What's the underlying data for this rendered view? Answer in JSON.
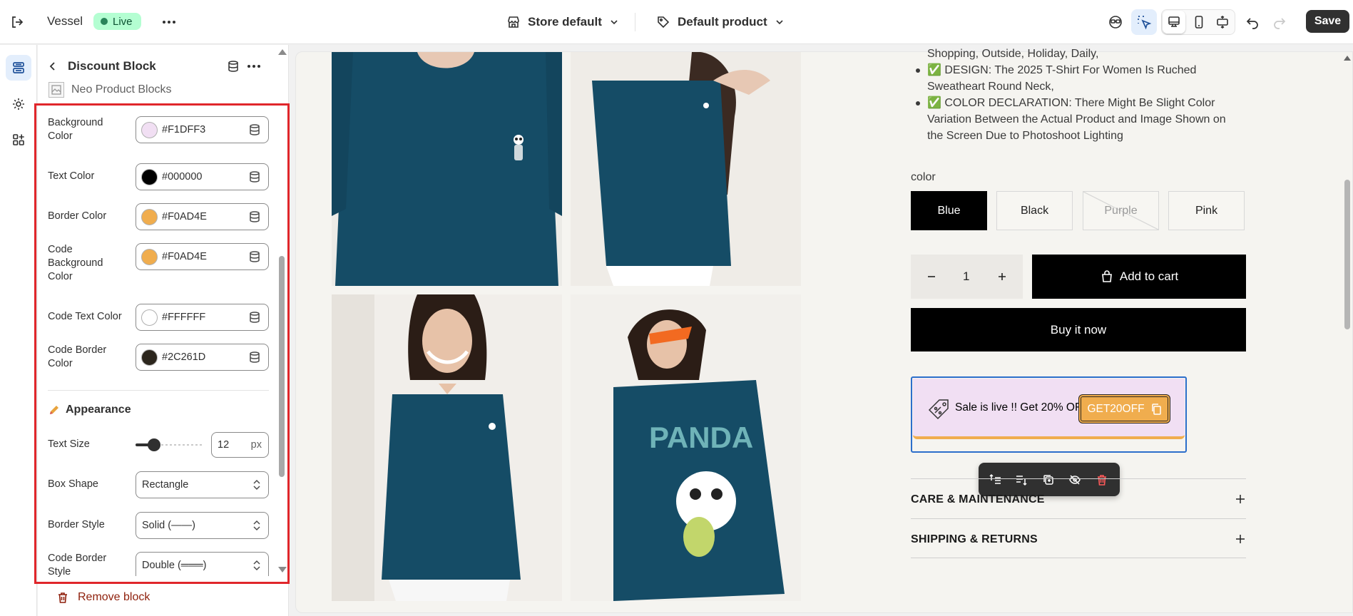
{
  "topbar": {
    "store_name": "Vessel",
    "status_badge": "Live",
    "theme_selector": "Store default",
    "template_selector": "Default product",
    "save_label": "Save"
  },
  "panel": {
    "title": "Discount Block",
    "app_name": "Neo Product Blocks",
    "fields": [
      {
        "label": "Background Color",
        "value": "#F1DFF3",
        "swatch": "#F1DFF3"
      },
      {
        "label": "Text Color",
        "value": "#000000",
        "swatch": "#000000"
      },
      {
        "label": "Border Color",
        "value": "#F0AD4E",
        "swatch": "#F0AD4E"
      },
      {
        "label": "Code Background Color",
        "value": "#F0AD4E",
        "swatch": "#F0AD4E"
      },
      {
        "label": "Code Text Color",
        "value": "#FFFFFF",
        "swatch": "#FFFFFF"
      },
      {
        "label": "Code Border Color",
        "value": "#2C261D",
        "swatch": "#2C261D"
      }
    ],
    "appearance_heading": "Appearance",
    "text_size_label": "Text Size",
    "text_size_value": "12",
    "text_size_unit": "px",
    "text_size_level": 0.1,
    "box_shape_label": "Box Shape",
    "box_shape_value": "Rectangle",
    "border_style_label": "Border Style",
    "border_style_value": "Solid (——)",
    "code_border_style_label": "Code Border Style",
    "code_border_style_value": "Double (═══)",
    "remove_label": "Remove block"
  },
  "product": {
    "desc_line0": "Shopping, Outside, Holiday, Daily,",
    "bullet1_a": "✅ DESIGN: The 2025 T-Shirt For Women Is Ruched",
    "bullet1_b": "Sweatheart Round Neck,",
    "bullet2_a": "✅ COLOR DECLARATION: There Might Be Slight Color",
    "bullet2_b": "Variation Between the Actual Product and Image Shown on",
    "bullet2_c": "the Screen Due to Photoshoot Lighting",
    "color_label": "color",
    "colors": [
      "Blue",
      "Black",
      "Purple",
      "Pink"
    ],
    "quantity": "1",
    "add_to_cart": "Add to cart",
    "buy_now": "Buy it now",
    "discount_text": "Sale is live !! Get 20% OFF",
    "discount_code": "GET20OFF",
    "accordions": [
      "CARE & MAINTENANCE",
      "SHIPPING & RETURNS"
    ]
  },
  "colors": {
    "accent_selected": "#F1DFF3",
    "code_bg": "#F0AD4E",
    "shirt": "#154c66",
    "frame_red": "#E0262B",
    "live_green": "#B4FED2"
  }
}
